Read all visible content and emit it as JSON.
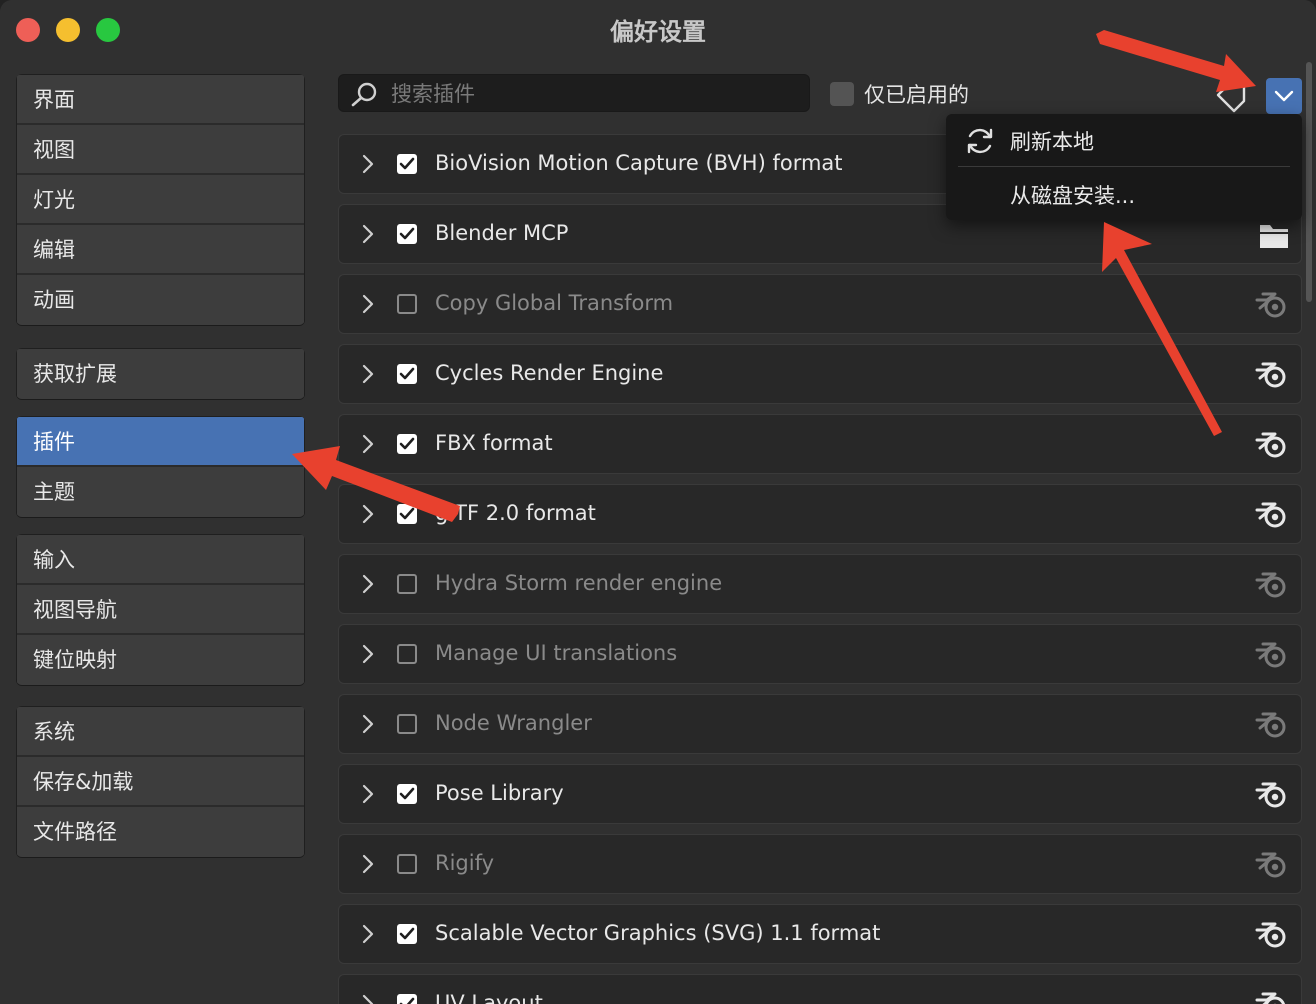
{
  "window": {
    "title": "偏好设置"
  },
  "sidebar": {
    "groups": [
      [
        "界面",
        "视图",
        "灯光",
        "编辑",
        "动画"
      ],
      [
        "获取扩展"
      ],
      [
        "插件",
        "主题"
      ],
      [
        "输入",
        "视图导航",
        "键位映射"
      ],
      [
        "系统",
        "保存&加载",
        "文件路径"
      ]
    ],
    "active": "插件"
  },
  "topbar": {
    "search_placeholder": "搜索插件",
    "enabled_only_label": "仅已启用的"
  },
  "menu": {
    "refresh_label": "刷新本地",
    "install_label": "从磁盘安装..."
  },
  "addons": [
    {
      "name": "BioVision Motion Capture (BVH) format",
      "enabled": true,
      "icon": "blender-icon"
    },
    {
      "name": "Blender MCP",
      "enabled": true,
      "icon": "folder-icon"
    },
    {
      "name": "Copy Global Transform",
      "enabled": false,
      "icon": "blender-icon"
    },
    {
      "name": "Cycles Render Engine",
      "enabled": true,
      "icon": "blender-icon"
    },
    {
      "name": "FBX format",
      "enabled": true,
      "icon": "blender-icon"
    },
    {
      "name": "glTF 2.0 format",
      "enabled": true,
      "icon": "blender-icon"
    },
    {
      "name": "Hydra Storm render engine",
      "enabled": false,
      "icon": "blender-icon"
    },
    {
      "name": "Manage UI translations",
      "enabled": false,
      "icon": "blender-icon"
    },
    {
      "name": "Node Wrangler",
      "enabled": false,
      "icon": "blender-icon"
    },
    {
      "name": "Pose Library",
      "enabled": true,
      "icon": "blender-icon"
    },
    {
      "name": "Rigify",
      "enabled": false,
      "icon": "blender-icon"
    },
    {
      "name": "Scalable Vector Graphics (SVG) 1.1 format",
      "enabled": true,
      "icon": "blender-icon"
    },
    {
      "name": "UV Layout",
      "enabled": true,
      "icon": "blender-icon"
    }
  ],
  "colors": {
    "accent": "#4772b3",
    "annotation_arrow": "#e8412e",
    "background": "#303030"
  }
}
